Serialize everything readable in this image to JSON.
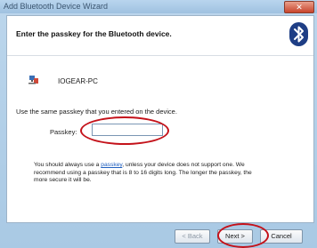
{
  "window": {
    "title": "Add Bluetooth Device Wizard",
    "close_glyph": "✕"
  },
  "header": {
    "heading": "Enter the passkey for the Bluetooth device.",
    "icon": "bluetooth-icon"
  },
  "device": {
    "name": "IOGEAR-PC",
    "icon": "device-icon"
  },
  "form": {
    "instruction": "Use the same passkey that you entered on the device.",
    "passkey_label": "Passkey:",
    "passkey_value": ""
  },
  "info": {
    "line1_before": "You should always use a ",
    "line1_link": "passkey",
    "line1_after": ", unless your device does not support one. We",
    "line2": "recommend using a passkey that is 8 to 16 digits long. The longer the passkey, the",
    "line3": "more secure it will be."
  },
  "buttons": {
    "back": "< Back",
    "next": "Next >",
    "cancel": "Cancel"
  },
  "colors": {
    "annotation": "#c4121a",
    "bluetooth_badge": "#1e3e85",
    "link": "#1f5fbf"
  }
}
